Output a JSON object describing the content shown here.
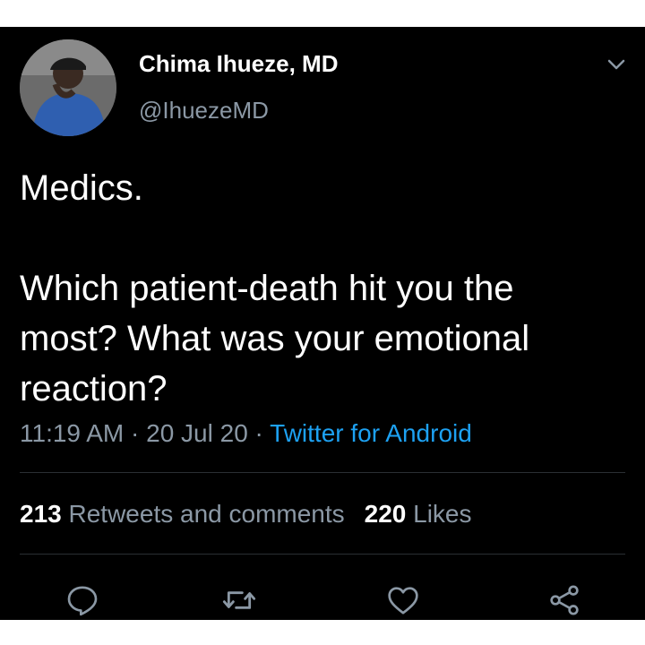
{
  "author": {
    "display_name": "Chima Ihueze, MD",
    "handle": "@IhuezeMD"
  },
  "tweet": {
    "line1": "Medics.",
    "line2": "Which patient-death hit you the most? What was your emotional reaction?"
  },
  "meta": {
    "time": "11:19 AM",
    "separator": " · ",
    "date": "20 Jul 20",
    "source": "Twitter for Android"
  },
  "stats": {
    "retweets_count": "213",
    "retweets_label": "Retweets and comments",
    "likes_count": "220",
    "likes_label": "Likes"
  },
  "actions": {
    "reply_icon": "reply-icon",
    "retweet_icon": "retweet-icon",
    "like_icon": "heart-icon",
    "share_icon": "share-icon"
  },
  "colors": {
    "background": "#000000",
    "text": "#ffffff",
    "secondary": "#8b98a5",
    "accent": "#1da1f2"
  }
}
